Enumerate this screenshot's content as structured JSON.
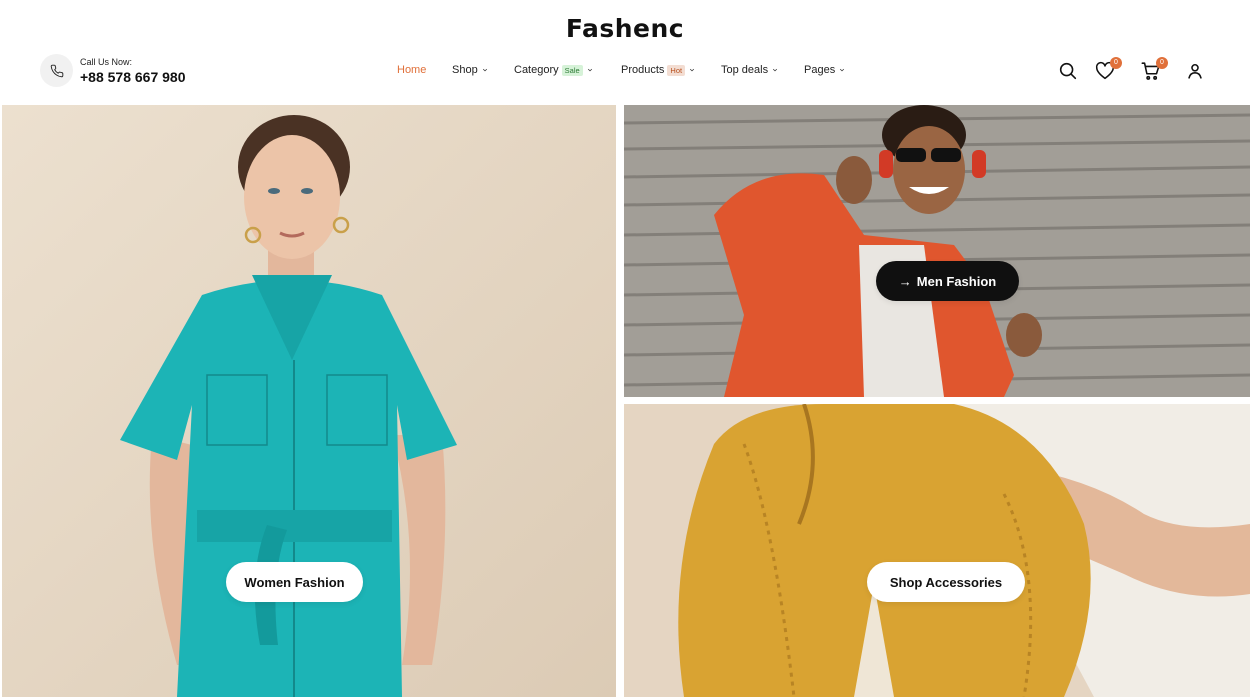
{
  "brand": {
    "logo": "Fashenc"
  },
  "contact": {
    "label": "Call Us Now:",
    "phone": "+88 578 667 980",
    "icon": "phone-icon"
  },
  "nav": {
    "items": [
      {
        "label": "Home",
        "active": true
      },
      {
        "label": "Shop",
        "dropdown": true
      },
      {
        "label": "Category",
        "badge": "Sale",
        "dropdown": true
      },
      {
        "label": "Products",
        "badge": "Hot",
        "dropdown": true
      },
      {
        "label": "Top deals",
        "dropdown": true
      },
      {
        "label": "Pages",
        "dropdown": true
      }
    ]
  },
  "header_icons": {
    "search": {
      "icon": "search-icon"
    },
    "wishlist": {
      "icon": "heart-icon",
      "count": "0"
    },
    "cart": {
      "icon": "cart-icon",
      "count": "0"
    },
    "account": {
      "icon": "user-icon"
    }
  },
  "banners": {
    "women": {
      "label": "Women Fashion"
    },
    "men": {
      "label": "Men Fashion",
      "arrow": "→"
    },
    "accessories": {
      "label": "Shop Accessories"
    }
  },
  "colors": {
    "accent": "#e0703a",
    "sale_badge": "#d6f2d8",
    "hot_badge": "#f3ddd2",
    "teal_jumpsuit": "#1cb4b6",
    "orange_jacket": "#e0562e",
    "mustard_bag": "#d9a332"
  }
}
